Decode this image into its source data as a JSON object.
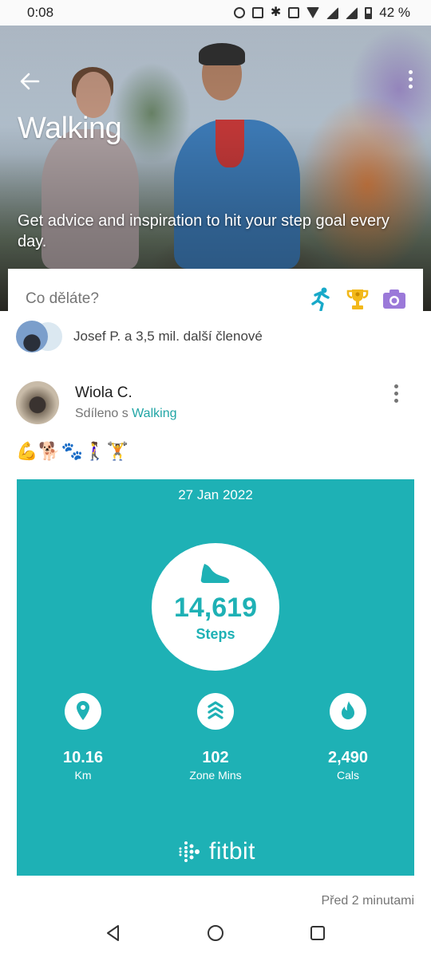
{
  "status_bar": {
    "time": "0:08",
    "battery": "42 %"
  },
  "hero": {
    "title": "Walking",
    "subtitle": "Get advice and inspiration to hit your step goal every day."
  },
  "compose": {
    "placeholder": "Co děláte?"
  },
  "members": {
    "text": "Josef P. a 3,5 mil. další členové"
  },
  "post": {
    "author": "Wiola C.",
    "shared_prefix": "Sdíleno s",
    "shared_group": "Walking",
    "emojis": "💪🐕🐾🚶‍♀️🏋️",
    "time_ago": "Před 2 minutami"
  },
  "card": {
    "date": "27 Jan 2022",
    "steps_value": "14,619",
    "steps_label": "Steps",
    "metrics": [
      {
        "icon": "location-pin-icon",
        "value": "10.16",
        "label": "Km"
      },
      {
        "icon": "zone-chevrons-icon",
        "value": "102",
        "label": "Zone Mins"
      },
      {
        "icon": "flame-icon",
        "value": "2,490",
        "label": "Cals"
      }
    ],
    "brand": "fitbit",
    "color": "#1eb1b5"
  },
  "colors": {
    "accent": "#20a5a5",
    "card_teal": "#1eb1b5"
  }
}
